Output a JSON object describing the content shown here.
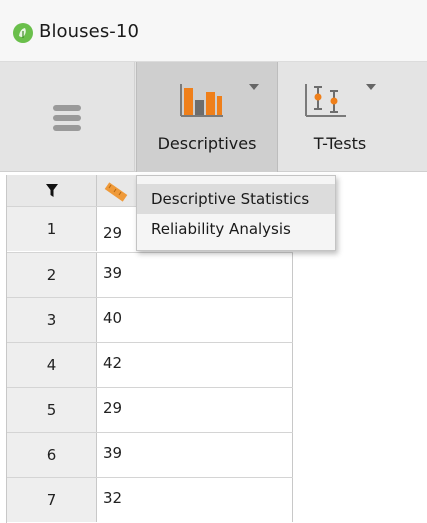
{
  "window": {
    "title": "Blouses-10"
  },
  "ribbon": {
    "menu_icon": "hamburger-menu-icon",
    "buttons": [
      {
        "label": "Descriptives",
        "icon": "bar-chart-icon",
        "active": true
      },
      {
        "label": "T-Tests",
        "icon": "t-test-icon",
        "active": false
      }
    ]
  },
  "grid": {
    "filter_icon": "filter-icon",
    "variable_icon": "ruler-scale-icon",
    "rows": [
      {
        "index": "1",
        "value": "29"
      },
      {
        "index": "2",
        "value": "39"
      },
      {
        "index": "3",
        "value": "40"
      },
      {
        "index": "4",
        "value": "42"
      },
      {
        "index": "5",
        "value": "29"
      },
      {
        "index": "6",
        "value": "39"
      },
      {
        "index": "7",
        "value": "32"
      }
    ]
  },
  "menu": {
    "items": [
      {
        "label": "Descriptive Statistics",
        "highlighted": true
      },
      {
        "label": "Reliability Analysis",
        "highlighted": false
      }
    ]
  },
  "colors": {
    "accent_orange": "#ef7f1a",
    "logo_green": "#6abf4b",
    "ribbon_bg": "#e4e4e4"
  }
}
